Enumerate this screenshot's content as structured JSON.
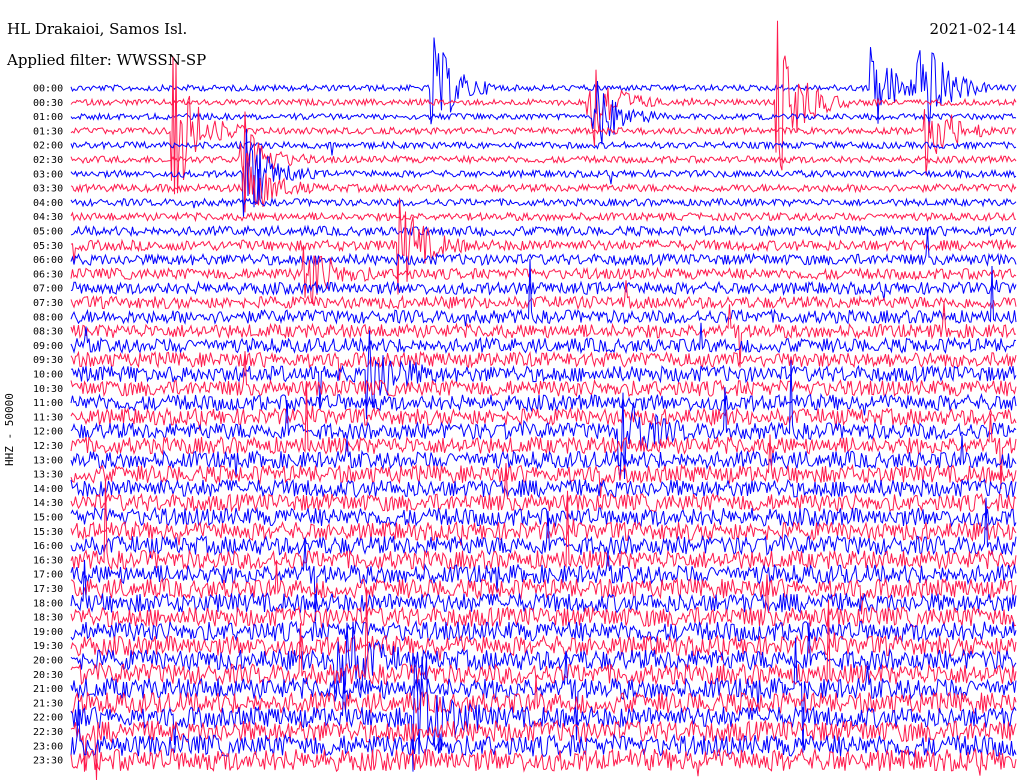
{
  "header": {
    "station": "HL Drakaioi, Samos Isl.",
    "filter": "Applied filter: WWSSN-SP",
    "date": "2021-02-14",
    "channel_label": "HHZ - 50000"
  },
  "colors": {
    "trace_even": "#0000ff",
    "trace_odd": "#ff1a4d",
    "text": "#000000",
    "background": "#ffffff"
  },
  "chart_data": {
    "type": "line",
    "title": "HL Drakaioi, Samos Isl.",
    "subtitle": "Applied filter: WWSSN-SP",
    "ylabel": "HHZ - 50000",
    "xlabel": "",
    "row_labels": [
      "00:00",
      "00:30",
      "01:00",
      "01:30",
      "02:00",
      "02:30",
      "03:00",
      "03:30",
      "04:00",
      "04:30",
      "05:00",
      "05:30",
      "06:00",
      "06:30",
      "07:00",
      "07:30",
      "08:00",
      "08:30",
      "09:00",
      "09:30",
      "10:00",
      "10:30",
      "11:00",
      "11:30",
      "12:00",
      "12:30",
      "13:00",
      "13:30",
      "14:00",
      "14:30",
      "15:00",
      "15:30",
      "16:00",
      "16:30",
      "17:00",
      "17:30",
      "18:00",
      "18:30",
      "19:00",
      "19:30",
      "20:00",
      "20:30",
      "21:00",
      "21:30",
      "22:00",
      "22:30",
      "23:00",
      "23:30"
    ],
    "row_minutes": 30,
    "noise_level": [
      0.15,
      0.15,
      0.15,
      0.2,
      0.2,
      0.22,
      0.22,
      0.3,
      0.25,
      0.3,
      0.45,
      0.55,
      0.6,
      0.6,
      0.7,
      0.7,
      0.8,
      0.85,
      0.9,
      0.95,
      1.05,
      1.05,
      1.05,
      1.1,
      1.1,
      1.15,
      1.15,
      1.2,
      1.2,
      1.2,
      1.25,
      1.25,
      1.3,
      1.3,
      1.3,
      1.35,
      1.35,
      1.4,
      1.4,
      1.4,
      1.45,
      1.45,
      1.5,
      1.5,
      1.5,
      1.55,
      1.55,
      1.6
    ],
    "events_minutes_into_row": [
      {
        "row": 0,
        "minute": 11.5,
        "amplitude": 6
      },
      {
        "row": 0,
        "minute": 27,
        "amplitude": 7
      },
      {
        "row": 0,
        "minute": 25.5,
        "amplitude": 5
      },
      {
        "row": 1,
        "minute": 16.5,
        "amplitude": 6
      },
      {
        "row": 1,
        "minute": 22.5,
        "amplitude": 9
      },
      {
        "row": 2,
        "minute": 16.7,
        "amplitude": 4
      },
      {
        "row": 3,
        "minute": 27.2,
        "amplitude": 5
      },
      {
        "row": 3,
        "minute": 3.3,
        "amplitude": 8
      },
      {
        "row": 5,
        "minute": 5.5,
        "amplitude": 4
      },
      {
        "row": 6,
        "minute": 5.6,
        "amplitude": 5
      },
      {
        "row": 7,
        "minute": 5.6,
        "amplitude": 4
      },
      {
        "row": 11,
        "minute": 10.5,
        "amplitude": 5
      },
      {
        "row": 13,
        "minute": 7.5,
        "amplitude": 4
      },
      {
        "row": 20,
        "minute": 9.5,
        "amplitude": 5
      },
      {
        "row": 24,
        "minute": 17.5,
        "amplitude": 5
      },
      {
        "row": 40,
        "minute": 8.5,
        "amplitude": 7
      },
      {
        "row": 44,
        "minute": 11.0,
        "amplitude": 9
      }
    ],
    "grid": false,
    "legend": "none"
  }
}
